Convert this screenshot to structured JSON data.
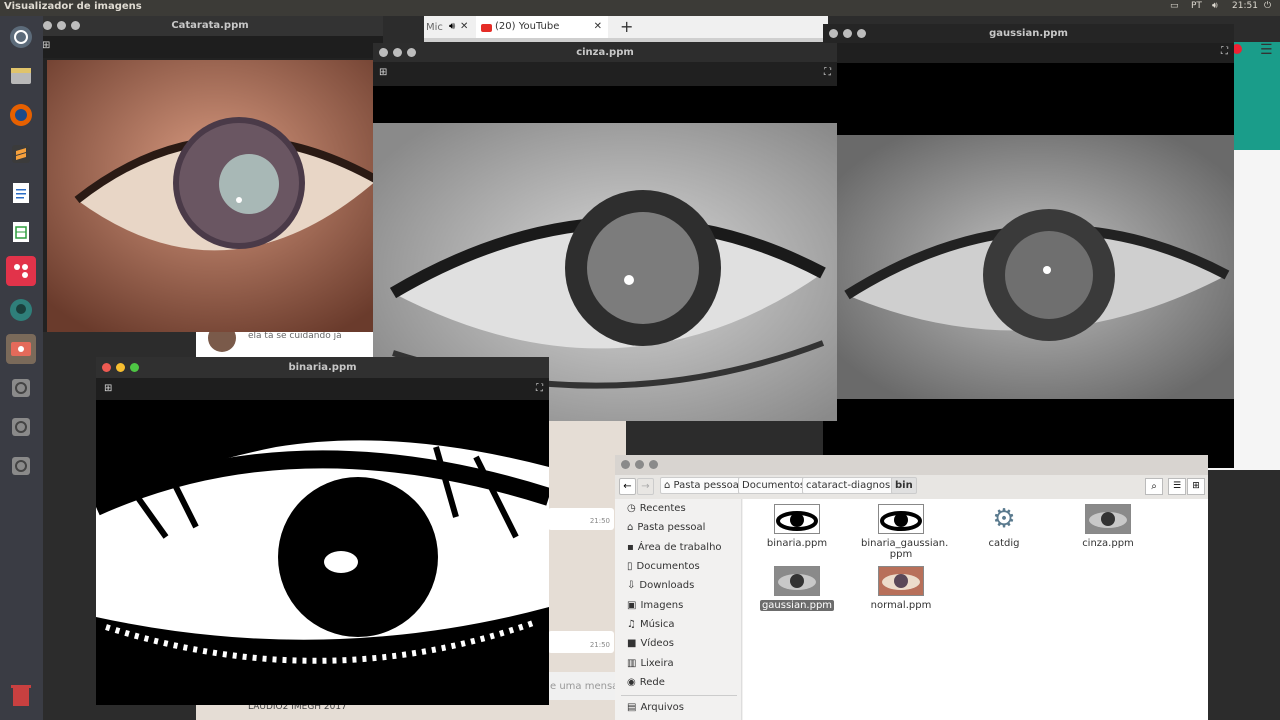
{
  "topbar": {
    "app_title": "Visualizador de imagens",
    "lang": "PT",
    "clock": "21:51"
  },
  "launcher": {
    "icons": [
      "ubuntu-icon",
      "files-icon",
      "firefox-icon",
      "sublime-icon",
      "writer-icon",
      "calc-icon",
      "flowchart-icon",
      "git-icon",
      "image-viewer-icon",
      "disk-icon",
      "disk-icon",
      "disk-icon",
      "trash-icon"
    ]
  },
  "browser": {
    "tab_partial": "Mic",
    "tab_youtube": "(20) YouTube"
  },
  "whatsapp": {
    "msg1": "ela tá se cuidando já",
    "time1": "21:50",
    "time2": "21:50",
    "input_placeholder": "e uma mensag",
    "partial_bottom": "LAUDIO2 IMEGH 2017"
  },
  "windows": {
    "catarata": {
      "title": "Catarata.ppm"
    },
    "cinza": {
      "title": "cinza.ppm"
    },
    "gaussian": {
      "title": "gaussian.ppm"
    },
    "binaria": {
      "title": "binaria.ppm"
    }
  },
  "filemanager": {
    "breadcrumb": [
      "Pasta pessoal",
      "Documentos",
      "cataract-diagnosis",
      "bin"
    ],
    "sidebar": [
      "Recentes",
      "Pasta pessoal",
      "Área de trabalho",
      "Documentos",
      "Downloads",
      "Imagens",
      "Música",
      "Vídeos",
      "Lixeira",
      "Rede",
      "Arquivos"
    ],
    "files": [
      "binaria.ppm",
      "binaria_gaussian.\nppm",
      "catdig",
      "cinza.ppm",
      "gaussian.ppm",
      "normal.ppm"
    ]
  },
  "colors": {
    "accent_teal": "#1a9d8a",
    "ubuntu_orange": "#e95420",
    "selection": "#6c6c6c"
  }
}
